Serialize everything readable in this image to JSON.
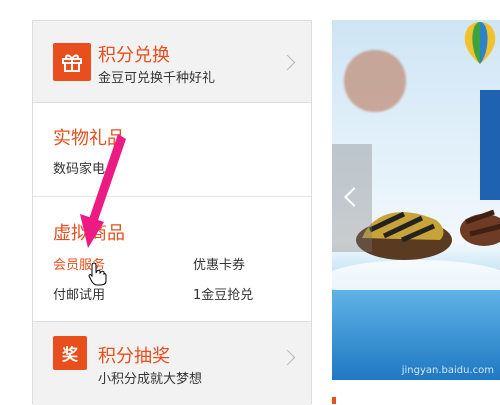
{
  "sidebar": {
    "points_exchange": {
      "title": "积分兑换",
      "subtitle": "金豆可兑换千种好礼",
      "icon": "gift-icon"
    },
    "physical_gifts": {
      "title": "实物礼品",
      "items": [
        {
          "label": "数码家电"
        }
      ]
    },
    "virtual_goods": {
      "title": "虚拟商品",
      "items": [
        {
          "label": "会员服务",
          "active": true
        },
        {
          "label": "优惠卡券"
        },
        {
          "label": "付邮试用"
        },
        {
          "label": "1金豆抢兑"
        }
      ]
    },
    "points_lottery": {
      "title": "积分抽奖",
      "subtitle": "小积分成就大梦想",
      "icon_text": "奖"
    }
  },
  "banner": {
    "watermark": "jingyan.baidu.com"
  },
  "colors": {
    "accent": "#e84f1c",
    "annotation_arrow": "#ec1a83"
  }
}
